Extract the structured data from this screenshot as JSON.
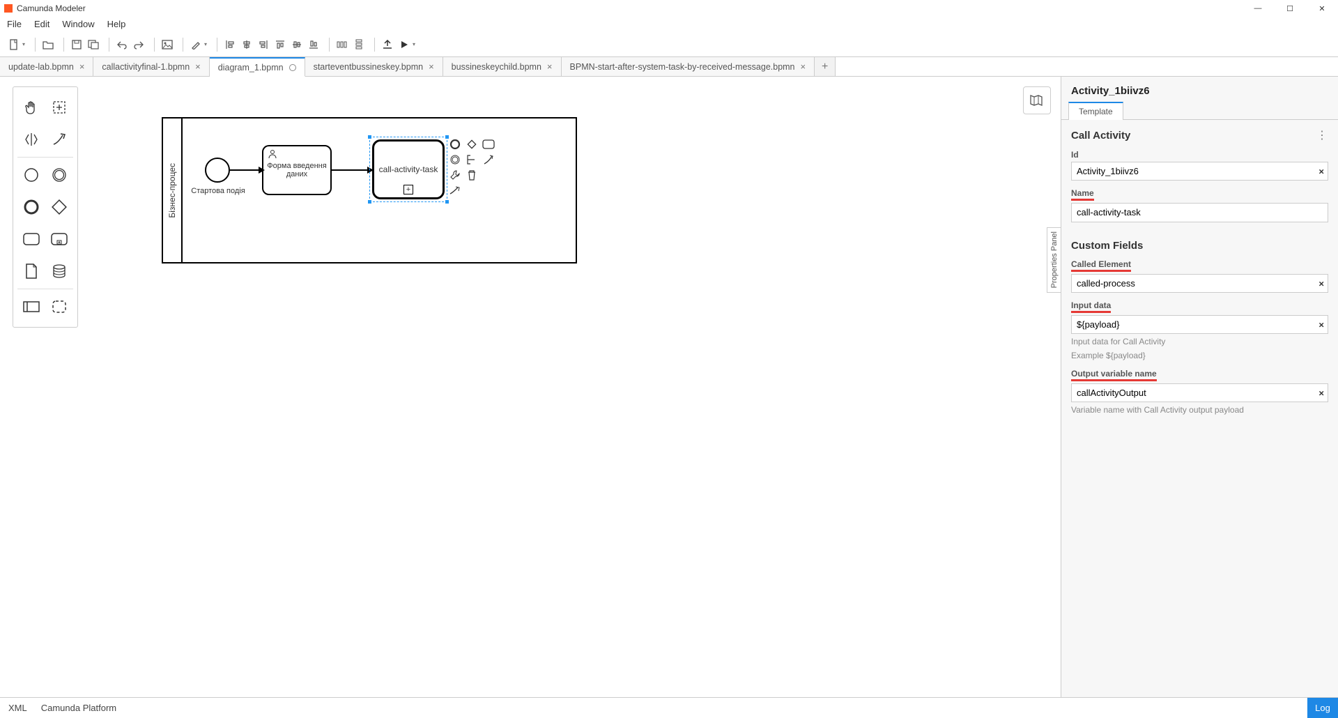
{
  "window": {
    "title": "Camunda Modeler"
  },
  "menu": {
    "items": [
      "File",
      "Edit",
      "Window",
      "Help"
    ]
  },
  "tabs": [
    {
      "label": "update-lab.bpmn",
      "closable": true
    },
    {
      "label": "callactivityfinal-1.bpmn",
      "closable": true
    },
    {
      "label": "diagram_1.bpmn",
      "active": true,
      "dirty": true
    },
    {
      "label": "starteventbussineskey.bpmn",
      "closable": true
    },
    {
      "label": "bussineskeychild.bpmn",
      "closable": true
    },
    {
      "label": "BPMN-start-after-system-task-by-received-message.bpmn",
      "closable": true
    }
  ],
  "diagram": {
    "pool_label": "Бізнес-процес",
    "start_event_label": "Стартова подія",
    "user_task_label": "Форма введення даних",
    "call_activity_label": "call-activity-task"
  },
  "properties": {
    "header": "Activity_1biivz6",
    "tab": "Template",
    "group1": "Call Activity",
    "id_label": "Id",
    "id_value": "Activity_1biivz6",
    "name_label": "Name",
    "name_value": "call-activity-task",
    "group2": "Custom Fields",
    "called_label": "Called Element",
    "called_value": "called-process",
    "input_label": "Input data",
    "input_value": "${payload}",
    "input_desc1": "Input data for Call Activity",
    "input_desc2": "Example ${payload}",
    "output_label": "Output variable name",
    "output_value": "callActivityOutput",
    "output_desc": "Variable name with Call Activity output payload"
  },
  "panel_toggle": "Properties Panel",
  "status": {
    "xml": "XML",
    "platform": "Camunda Platform",
    "log": "Log"
  }
}
